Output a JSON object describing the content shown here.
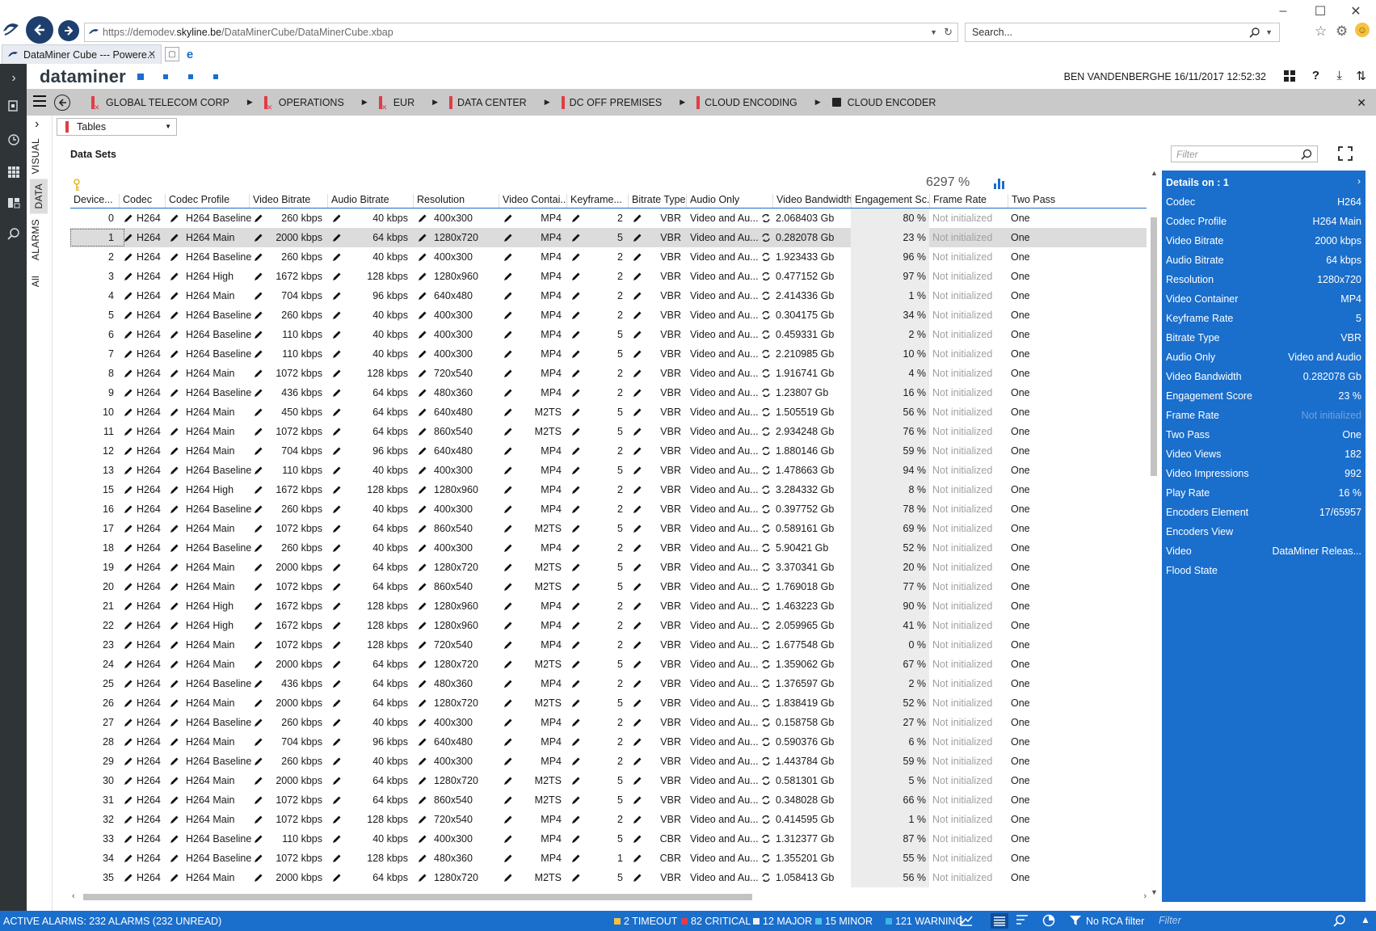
{
  "browser": {
    "url_prefix": "https://demodev.",
    "url_domain": "skyline.be",
    "url_path": "/DataMinerCube/DataMinerCube.xbap",
    "search_placeholder": "Search...",
    "tab_title": "DataMiner Cube --- Powere..."
  },
  "app": {
    "logo": "dataminer",
    "user": "BEN VANDENBERGHE",
    "datetime": "16/11/2017 12:52:32"
  },
  "breadcrumb": [
    {
      "label": "GLOBAL TELECOM CORP",
      "alarm": true
    },
    {
      "label": "OPERATIONS",
      "alarm": true
    },
    {
      "label": "EUR",
      "alarm": true
    },
    {
      "label": "DATA CENTER",
      "alarm": false
    },
    {
      "label": "DC OFF PREMISES",
      "alarm": false
    },
    {
      "label": "CLOUD ENCODING",
      "alarm": false
    },
    {
      "label": "CLOUD ENCODER",
      "alarm": false
    }
  ],
  "side_tabs": [
    "VISUAL",
    "DATA",
    "ALARMS",
    "All"
  ],
  "tables_dropdown": "Tables",
  "dataset_title": "Data Sets",
  "filter_placeholder": "Filter",
  "engagement_summary": "6297 %",
  "columns": [
    "Device...",
    "Codec",
    "Codec Profile",
    "Video Bitrate",
    "Audio Bitrate",
    "Resolution",
    "Video Contai...",
    "Keyframe...",
    "Bitrate Type",
    "Audio Only",
    "Video Bandwidth",
    "Engagement Sc...",
    "Frame Rate",
    "Two Pass"
  ],
  "rows": [
    [
      "0",
      "H264",
      "H264 Baseline",
      "260 kbps",
      "40 kbps",
      "400x300",
      "MP4",
      "2",
      "VBR",
      "Video and Au...",
      "2.068403 Gb",
      "80 %",
      "Not initialized",
      "One"
    ],
    [
      "1",
      "H264",
      "H264 Main",
      "2000 kbps",
      "64 kbps",
      "1280x720",
      "MP4",
      "5",
      "VBR",
      "Video and Au...",
      "0.282078 Gb",
      "23 %",
      "Not initialized",
      "One"
    ],
    [
      "2",
      "H264",
      "H264 Baseline",
      "260 kbps",
      "40 kbps",
      "400x300",
      "MP4",
      "2",
      "VBR",
      "Video and Au...",
      "1.923433 Gb",
      "96 %",
      "Not initialized",
      "One"
    ],
    [
      "3",
      "H264",
      "H264 High",
      "1672 kbps",
      "128 kbps",
      "1280x960",
      "MP4",
      "2",
      "VBR",
      "Video and Au...",
      "0.477152 Gb",
      "97 %",
      "Not initialized",
      "One"
    ],
    [
      "4",
      "H264",
      "H264 Main",
      "704 kbps",
      "96 kbps",
      "640x480",
      "MP4",
      "2",
      "VBR",
      "Video and Au...",
      "2.414336 Gb",
      "1 %",
      "Not initialized",
      "One"
    ],
    [
      "5",
      "H264",
      "H264 Baseline",
      "260 kbps",
      "40 kbps",
      "400x300",
      "MP4",
      "2",
      "VBR",
      "Video and Au...",
      "0.304175 Gb",
      "34 %",
      "Not initialized",
      "One"
    ],
    [
      "6",
      "H264",
      "H264 Baseline",
      "110 kbps",
      "40 kbps",
      "400x300",
      "MP4",
      "5",
      "VBR",
      "Video and Au...",
      "0.459331 Gb",
      "2 %",
      "Not initialized",
      "One"
    ],
    [
      "7",
      "H264",
      "H264 Baseline",
      "110 kbps",
      "40 kbps",
      "400x300",
      "MP4",
      "5",
      "VBR",
      "Video and Au...",
      "2.210985 Gb",
      "10 %",
      "Not initialized",
      "One"
    ],
    [
      "8",
      "H264",
      "H264 Main",
      "1072 kbps",
      "128 kbps",
      "720x540",
      "MP4",
      "2",
      "VBR",
      "Video and Au...",
      "1.916741 Gb",
      "4 %",
      "Not initialized",
      "One"
    ],
    [
      "9",
      "H264",
      "H264 Baseline",
      "436 kbps",
      "64 kbps",
      "480x360",
      "MP4",
      "2",
      "VBR",
      "Video and Au...",
      "1.23807 Gb",
      "16 %",
      "Not initialized",
      "One"
    ],
    [
      "10",
      "H264",
      "H264 Main",
      "450 kbps",
      "64 kbps",
      "640x480",
      "M2TS",
      "5",
      "VBR",
      "Video and Au...",
      "1.505519 Gb",
      "56 %",
      "Not initialized",
      "One"
    ],
    [
      "11",
      "H264",
      "H264 Main",
      "1072 kbps",
      "64 kbps",
      "860x540",
      "M2TS",
      "5",
      "VBR",
      "Video and Au...",
      "2.934248 Gb",
      "76 %",
      "Not initialized",
      "One"
    ],
    [
      "12",
      "H264",
      "H264 Main",
      "704 kbps",
      "96 kbps",
      "640x480",
      "MP4",
      "2",
      "VBR",
      "Video and Au...",
      "1.880146 Gb",
      "59 %",
      "Not initialized",
      "One"
    ],
    [
      "13",
      "H264",
      "H264 Baseline",
      "110 kbps",
      "40 kbps",
      "400x300",
      "MP4",
      "5",
      "VBR",
      "Video and Au...",
      "1.478663 Gb",
      "94 %",
      "Not initialized",
      "One"
    ],
    [
      "15",
      "H264",
      "H264 High",
      "1672 kbps",
      "128 kbps",
      "1280x960",
      "MP4",
      "2",
      "VBR",
      "Video and Au...",
      "3.284332 Gb",
      "8 %",
      "Not initialized",
      "One"
    ],
    [
      "16",
      "H264",
      "H264 Baseline",
      "260 kbps",
      "40 kbps",
      "400x300",
      "MP4",
      "2",
      "VBR",
      "Video and Au...",
      "0.397752 Gb",
      "78 %",
      "Not initialized",
      "One"
    ],
    [
      "17",
      "H264",
      "H264 Main",
      "1072 kbps",
      "64 kbps",
      "860x540",
      "M2TS",
      "5",
      "VBR",
      "Video and Au...",
      "0.589161 Gb",
      "69 %",
      "Not initialized",
      "One"
    ],
    [
      "18",
      "H264",
      "H264 Baseline",
      "260 kbps",
      "40 kbps",
      "400x300",
      "MP4",
      "2",
      "VBR",
      "Video and Au...",
      "5.90421 Gb",
      "52 %",
      "Not initialized",
      "One"
    ],
    [
      "19",
      "H264",
      "H264 Main",
      "2000 kbps",
      "64 kbps",
      "1280x720",
      "M2TS",
      "5",
      "VBR",
      "Video and Au...",
      "3.370341 Gb",
      "20 %",
      "Not initialized",
      "One"
    ],
    [
      "20",
      "H264",
      "H264 Main",
      "1072 kbps",
      "64 kbps",
      "860x540",
      "M2TS",
      "5",
      "VBR",
      "Video and Au...",
      "1.769018 Gb",
      "77 %",
      "Not initialized",
      "One"
    ],
    [
      "21",
      "H264",
      "H264 High",
      "1672 kbps",
      "128 kbps",
      "1280x960",
      "MP4",
      "2",
      "VBR",
      "Video and Au...",
      "1.463223 Gb",
      "90 %",
      "Not initialized",
      "One"
    ],
    [
      "22",
      "H264",
      "H264 High",
      "1672 kbps",
      "128 kbps",
      "1280x960",
      "MP4",
      "2",
      "VBR",
      "Video and Au...",
      "2.059965 Gb",
      "41 %",
      "Not initialized",
      "One"
    ],
    [
      "23",
      "H264",
      "H264 Main",
      "1072 kbps",
      "128 kbps",
      "720x540",
      "MP4",
      "2",
      "VBR",
      "Video and Au...",
      "1.677548 Gb",
      "0 %",
      "Not initialized",
      "One"
    ],
    [
      "24",
      "H264",
      "H264 Main",
      "2000 kbps",
      "64 kbps",
      "1280x720",
      "M2TS",
      "5",
      "VBR",
      "Video and Au...",
      "1.359062 Gb",
      "67 %",
      "Not initialized",
      "One"
    ],
    [
      "25",
      "H264",
      "H264 Baseline",
      "436 kbps",
      "64 kbps",
      "480x360",
      "MP4",
      "2",
      "VBR",
      "Video and Au...",
      "1.376597 Gb",
      "2 %",
      "Not initialized",
      "One"
    ],
    [
      "26",
      "H264",
      "H264 Main",
      "2000 kbps",
      "64 kbps",
      "1280x720",
      "M2TS",
      "5",
      "VBR",
      "Video and Au...",
      "1.838419 Gb",
      "52 %",
      "Not initialized",
      "One"
    ],
    [
      "27",
      "H264",
      "H264 Baseline",
      "260 kbps",
      "40 kbps",
      "400x300",
      "MP4",
      "2",
      "VBR",
      "Video and Au...",
      "0.158758 Gb",
      "27 %",
      "Not initialized",
      "One"
    ],
    [
      "28",
      "H264",
      "H264 Main",
      "704 kbps",
      "96 kbps",
      "640x480",
      "MP4",
      "2",
      "VBR",
      "Video and Au...",
      "0.590376 Gb",
      "6 %",
      "Not initialized",
      "One"
    ],
    [
      "29",
      "H264",
      "H264 Baseline",
      "260 kbps",
      "40 kbps",
      "400x300",
      "MP4",
      "2",
      "VBR",
      "Video and Au...",
      "1.443784 Gb",
      "59 %",
      "Not initialized",
      "One"
    ],
    [
      "30",
      "H264",
      "H264 Main",
      "2000 kbps",
      "64 kbps",
      "1280x720",
      "M2TS",
      "5",
      "VBR",
      "Video and Au...",
      "0.581301 Gb",
      "5 %",
      "Not initialized",
      "One"
    ],
    [
      "31",
      "H264",
      "H264 Main",
      "1072 kbps",
      "64 kbps",
      "860x540",
      "M2TS",
      "5",
      "VBR",
      "Video and Au...",
      "0.348028 Gb",
      "66 %",
      "Not initialized",
      "One"
    ],
    [
      "32",
      "H264",
      "H264 Main",
      "1072 kbps",
      "128 kbps",
      "720x540",
      "MP4",
      "2",
      "VBR",
      "Video and Au...",
      "0.414595 Gb",
      "1 %",
      "Not initialized",
      "One"
    ],
    [
      "33",
      "H264",
      "H264 Baseline",
      "110 kbps",
      "40 kbps",
      "400x300",
      "MP4",
      "5",
      "CBR",
      "Video and Au...",
      "1.312377 Gb",
      "87 %",
      "Not initialized",
      "One"
    ],
    [
      "34",
      "H264",
      "H264 Baseline",
      "1072 kbps",
      "128 kbps",
      "480x360",
      "MP4",
      "1",
      "CBR",
      "Video and Au...",
      "1.355201 Gb",
      "55 %",
      "Not initialized",
      "One"
    ],
    [
      "35",
      "H264",
      "H264 Main",
      "2000 kbps",
      "64 kbps",
      "1280x720",
      "M2TS",
      "5",
      "VBR",
      "Video and Au...",
      "1.058413 Gb",
      "56 %",
      "Not initialized",
      "One"
    ]
  ],
  "selected_row": 1,
  "details": {
    "title": "Details on : 1",
    "items": [
      {
        "label": "Codec",
        "value": "H264"
      },
      {
        "label": "Codec Profile",
        "value": "H264 Main"
      },
      {
        "label": "Video Bitrate",
        "value": "2000 kbps"
      },
      {
        "label": "Audio Bitrate",
        "value": "64 kbps"
      },
      {
        "label": "Resolution",
        "value": "1280x720"
      },
      {
        "label": "Video Container",
        "value": "MP4"
      },
      {
        "label": "Keyframe Rate",
        "value": "5"
      },
      {
        "label": "Bitrate Type",
        "value": "VBR"
      },
      {
        "label": "Audio Only",
        "value": "Video and Audio"
      },
      {
        "label": "Video Bandwidth",
        "value": "0.282078 Gb"
      },
      {
        "label": "Engagement Score",
        "value": "23 %"
      },
      {
        "label": "Frame Rate",
        "value": "Not initialized"
      },
      {
        "label": "Two Pass",
        "value": "One"
      },
      {
        "label": "Video Views",
        "value": "182"
      },
      {
        "label": "Video Impressions",
        "value": "992"
      },
      {
        "label": "Play Rate",
        "value": "16 %"
      },
      {
        "label": "Encoders Element",
        "value": "17/65957"
      },
      {
        "label": "Encoders View",
        "value": ""
      },
      {
        "label": "Video",
        "value": "DataMiner Releas..."
      },
      {
        "label": "Flood State",
        "value": ""
      }
    ]
  },
  "status_bar": {
    "active_alarms": "ACTIVE ALARMS: 232 ALARMS (232 UNREAD)",
    "severities": [
      {
        "label": "2 TIMEOUT",
        "color": "#f5c242"
      },
      {
        "label": "82 CRITICAL",
        "color": "#e23c46"
      },
      {
        "label": "12 MAJOR",
        "color": "#f0f0f0"
      },
      {
        "label": "15 MINOR",
        "color": "#4fc3e8"
      },
      {
        "label": "121 WARNING",
        "color": "#3cb4e6"
      }
    ],
    "rca_filter": "No RCA filter",
    "filter_placeholder": "Filter"
  },
  "colors": {
    "accent": "#1a6ecc",
    "alarm_flag": "#e23c46",
    "rail": "#2f3437"
  }
}
